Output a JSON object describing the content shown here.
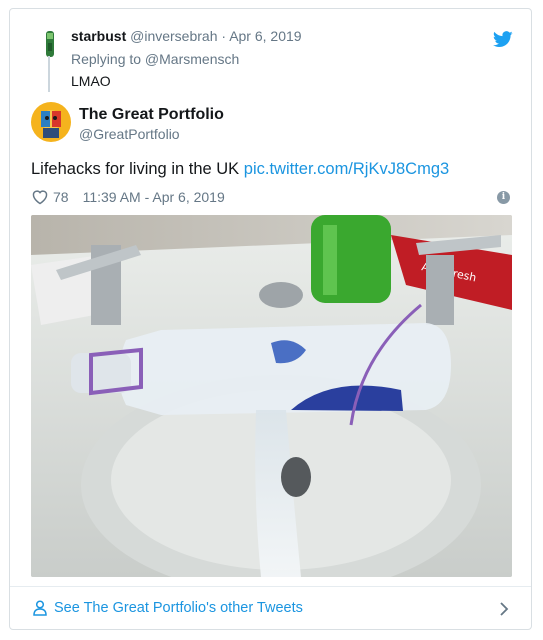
{
  "reply": {
    "name": "starbust",
    "handle": "@inversebrah",
    "separator": "·",
    "date": "Apr 6, 2019",
    "replying_to": "Replying to @Marsmensch",
    "text": "LMAO"
  },
  "tweet": {
    "name": "The Great Portfolio",
    "handle": "@GreatPortfolio",
    "text": "Lifehacks for living in the UK",
    "link": "pic.twitter.com/RjKvJ8Cmg3",
    "likes": "78",
    "timestamp": "11:39 AM - Apr 6, 2019"
  },
  "footer": {
    "label": "See The Great Portfolio's other Tweets"
  },
  "icons": {
    "bird": "twitter-bird-icon",
    "heart": "heart-icon",
    "info": "info-icon",
    "person": "person-icon",
    "chevron": "chevron-right-icon"
  },
  "colors": {
    "link": "#1b95e0",
    "secondary_text": "#657786",
    "border": "#d9dfe3",
    "photo_bottle_label": "#2a3f9e",
    "photo_green_bottle": "#3aa82f",
    "photo_toothpaste": "#c01d25"
  }
}
